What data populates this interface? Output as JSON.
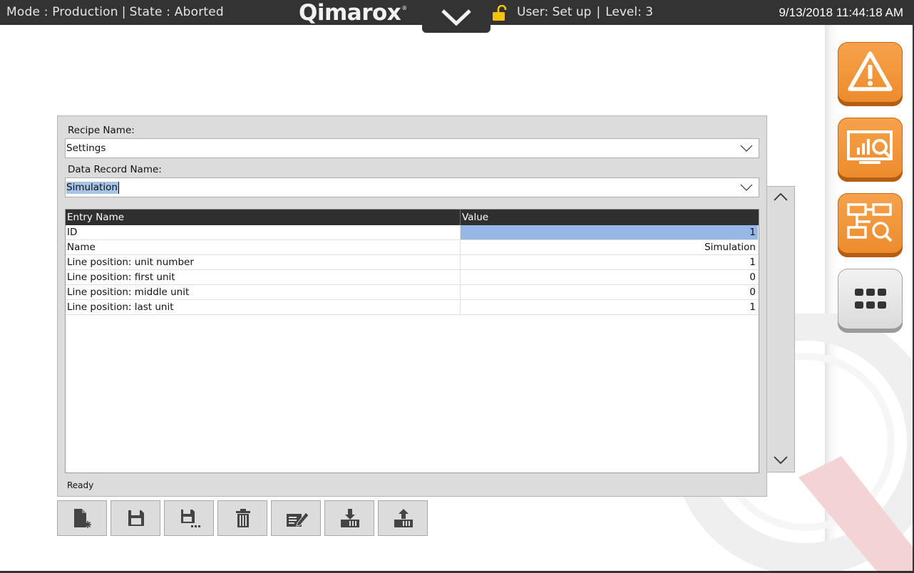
{
  "topbar": {
    "mode_label": "Mode : Production",
    "separator": "|",
    "state_label": "State : Aborted",
    "logo": "Qimarox",
    "logo_mark": "®",
    "user_label": "User: Set up",
    "level_label": "Level: 3",
    "datetime": "9/13/2018 11:44:18 AM"
  },
  "side_buttons": [
    {
      "name": "alarms",
      "icon": "warning-icon",
      "color": "#ef8f2f"
    },
    {
      "name": "statistics",
      "icon": "monitor-chart-icon",
      "color": "#ef8f2f"
    },
    {
      "name": "diagnostics",
      "icon": "diagram-search-icon",
      "color": "#ef8f2f"
    },
    {
      "name": "menu",
      "icon": "grid-dots-icon",
      "color": "#e6e6e6"
    }
  ],
  "recipe": {
    "recipe_name_label": "Recipe Name:",
    "recipe_name_value": "Settings",
    "data_record_label": "Data Record Name:",
    "data_record_value": "Simulation"
  },
  "grid": {
    "columns": [
      "Entry Name",
      "Value"
    ],
    "rows": [
      {
        "name": "ID",
        "value": "1",
        "selected": true
      },
      {
        "name": "Name",
        "value": "Simulation"
      },
      {
        "name": "Line position: unit number",
        "value": "1"
      },
      {
        "name": "Line position: first unit",
        "value": "0"
      },
      {
        "name": "Line position: middle unit",
        "value": "0"
      },
      {
        "name": "Line position: last unit",
        "value": "1"
      }
    ]
  },
  "status_text": "Ready",
  "toolbar": [
    {
      "name": "new-record",
      "icon": "new-document-icon"
    },
    {
      "name": "save",
      "icon": "save-icon"
    },
    {
      "name": "save-as",
      "icon": "save-as-icon"
    },
    {
      "name": "delete",
      "icon": "trash-icon"
    },
    {
      "name": "rename",
      "icon": "edit-icon"
    },
    {
      "name": "download-to-plc",
      "icon": "download-icon"
    },
    {
      "name": "upload-from-plc",
      "icon": "upload-icon"
    }
  ],
  "colors": {
    "topbar": "#333333",
    "accent_orange": "#ef8f2f",
    "selection": "#97b7e6",
    "panel": "#dcdcdc"
  }
}
